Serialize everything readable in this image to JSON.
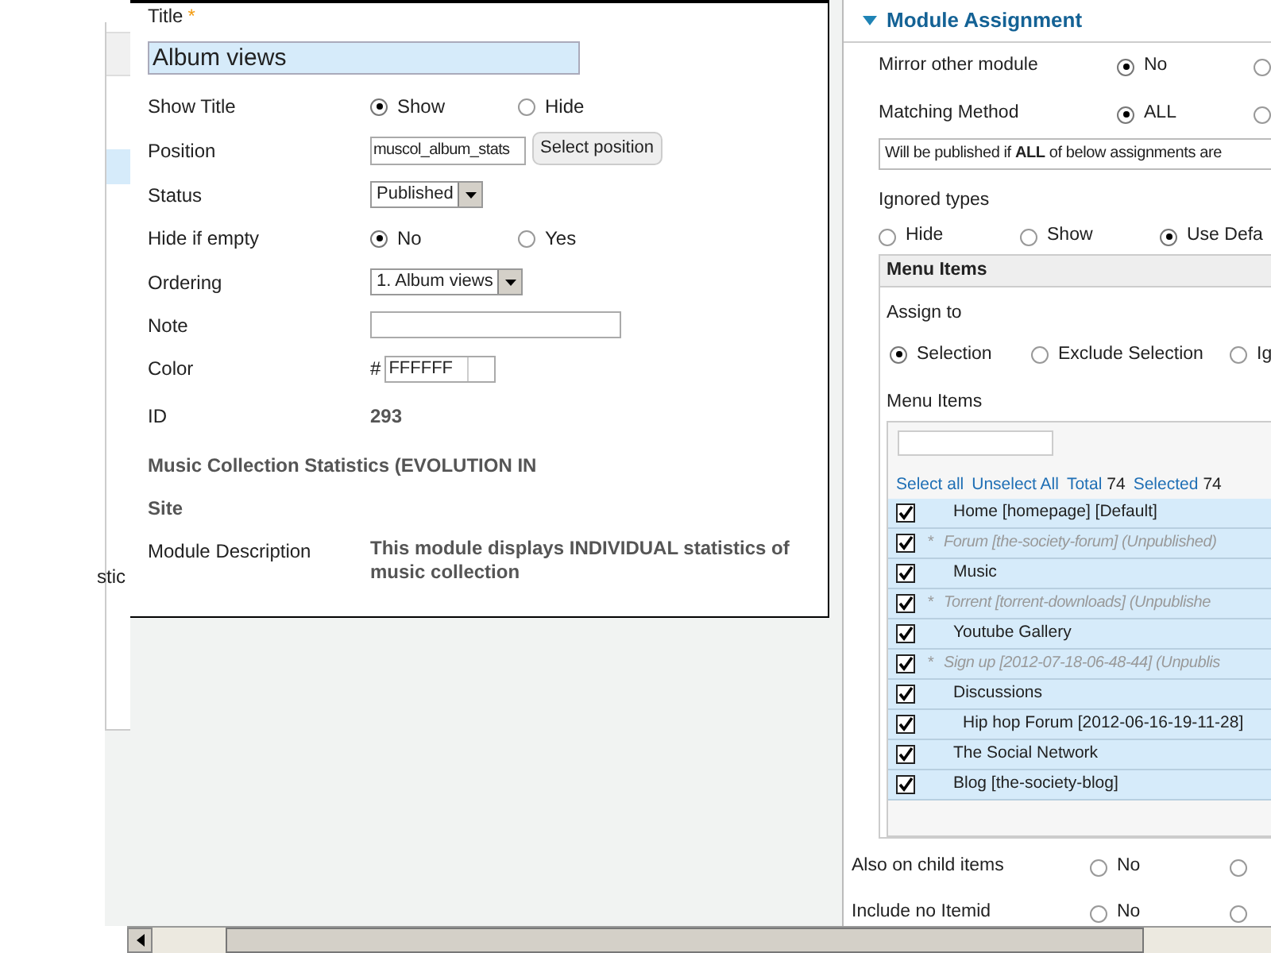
{
  "background_page": {
    "fragment": "stic"
  },
  "module_form": {
    "title_label": "Title",
    "required_mark": "*",
    "title_value": "Album views",
    "fields": [
      {
        "kind": "radio",
        "label": "Show Title",
        "options": [
          {
            "label": "Show",
            "selected": true
          },
          {
            "label": "Hide",
            "selected": false
          }
        ]
      },
      {
        "kind": "position",
        "label": "Position",
        "value": "muscol_album_stats",
        "button": "Select position"
      },
      {
        "kind": "select",
        "label": "Status",
        "value": "Published"
      },
      {
        "kind": "radio",
        "label": "Hide if empty",
        "options": [
          {
            "label": "No",
            "selected": true
          },
          {
            "label": "Yes",
            "selected": false
          }
        ]
      },
      {
        "kind": "select",
        "label": "Ordering",
        "value": "1. Album views"
      },
      {
        "kind": "text",
        "label": "Note"
      },
      {
        "kind": "color",
        "label": "Color",
        "prefix": "#",
        "value": "FFFFFF"
      },
      {
        "kind": "readonly",
        "label": "ID",
        "value": "293"
      },
      {
        "kind": "heading",
        "label": "Music Collection Statistics (EVOLUTION IN"
      },
      {
        "kind": "heading",
        "label": "Site"
      },
      {
        "kind": "readonly",
        "label": "Module Description",
        "value": "This module displays INDIVIDUAL statistics of music collection"
      }
    ]
  },
  "module_assignment": {
    "title": "Module Assignment",
    "expanded": true,
    "rows": [
      {
        "label": "Mirror other module",
        "options": [
          {
            "label": "No",
            "selected": true
          },
          {
            "selected": false
          }
        ]
      },
      {
        "label": "Matching Method",
        "options": [
          {
            "label": "ALL",
            "selected": true
          },
          {
            "selected": false
          }
        ]
      }
    ],
    "info": "Will be published if **ALL** of below assignments are",
    "ignored_types": {
      "label": "Ignored types",
      "options": [
        {
          "label": "Hide",
          "selected": false
        },
        {
          "label": "Show",
          "selected": false
        },
        {
          "label": "Use Defa",
          "selected": true
        }
      ]
    },
    "menu_items": {
      "title": "Menu Items",
      "assign_label": "Assign to",
      "assign_options": [
        {
          "label": "Selection",
          "selected": true
        },
        {
          "label": "Exclude Selection",
          "selected": false
        },
        {
          "label": "Ig",
          "selected": false
        }
      ],
      "list_label": "Menu Items",
      "links": [
        "Select all",
        "Unselect All"
      ],
      "total_label": "Total",
      "total": "74",
      "selected_label": "Selected",
      "selected_count": "74",
      "items": [
        {
          "label": "Home [homepage] [Default]",
          "published": true,
          "checked": true
        },
        {
          "label": "Forum [the-society-forum] (Unpublished)",
          "published": false,
          "checked": true
        },
        {
          "label": "Music",
          "published": true,
          "checked": true
        },
        {
          "label": "Torrent [torrent-downloads] (Unpublishe",
          "published": false,
          "checked": true
        },
        {
          "label": "Youtube Gallery",
          "published": true,
          "checked": true
        },
        {
          "label": "Sign up [2012-07-18-06-48-44] (Unpublis",
          "published": false,
          "checked": true
        },
        {
          "label": "Discussions",
          "published": true,
          "checked": true,
          "children": [
            {
              "label": "Hip hop Forum [2012-06-16-19-11-28]",
              "published": true,
              "checked": true
            }
          ]
        },
        {
          "label": "The Social Network",
          "published": true,
          "checked": true
        },
        {
          "label": "Blog [the-society-blog]",
          "published": true,
          "checked": true
        }
      ]
    },
    "bottom_rows": [
      {
        "label": "Also on child items",
        "options": [
          {
            "label": "No",
            "selected": false
          },
          {
            "selected": false
          }
        ]
      },
      {
        "label": "Include no Itemid",
        "options": [
          {
            "label": "No",
            "selected": false
          },
          {
            "selected": false
          }
        ]
      }
    ]
  }
}
